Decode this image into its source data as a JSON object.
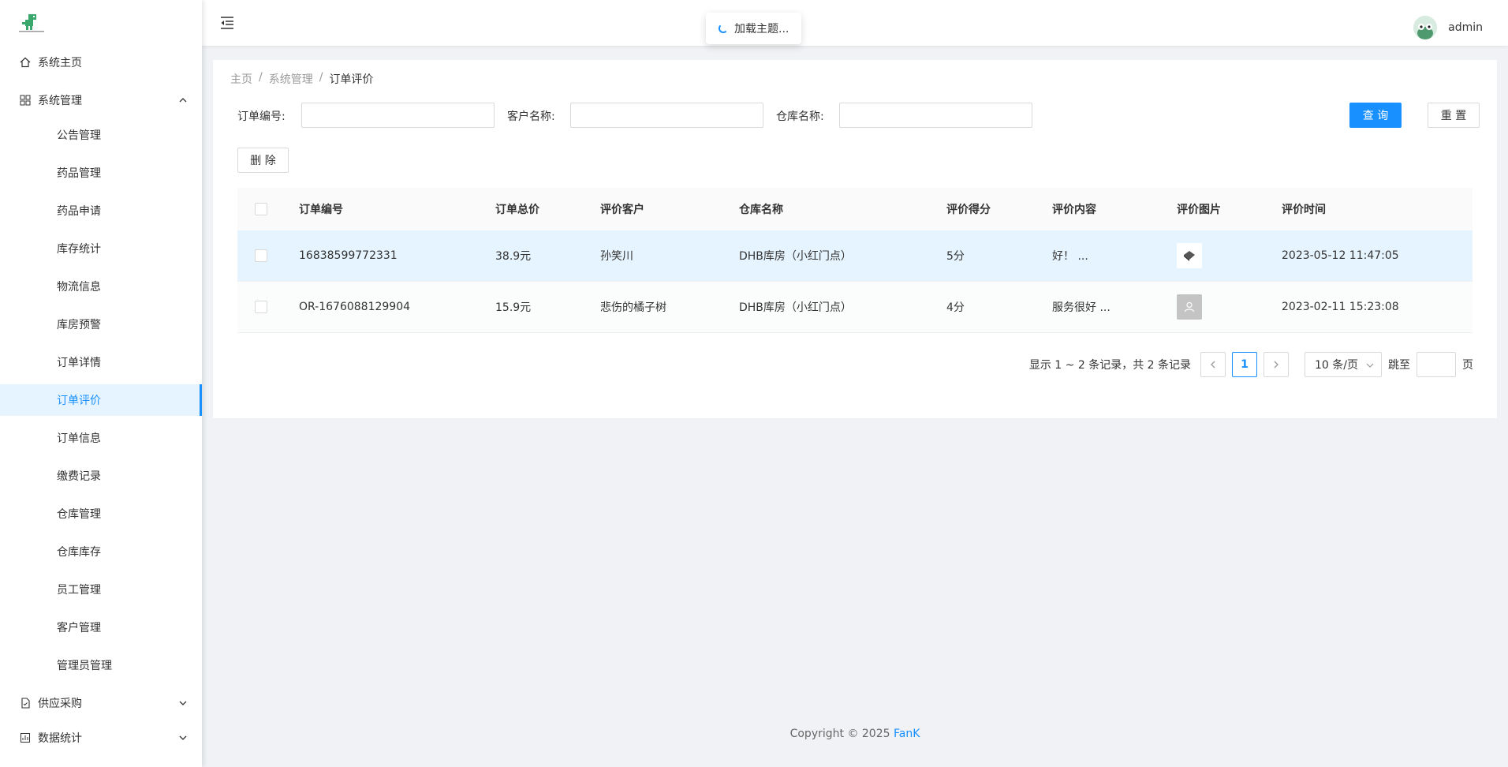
{
  "sidebar": {
    "items": [
      {
        "label": "系统主页",
        "icon": "home-icon",
        "level": 1
      },
      {
        "label": "系统管理",
        "icon": "appstore-icon",
        "level": 1,
        "expanded": true
      },
      {
        "label": "公告管理",
        "level": 2
      },
      {
        "label": "药品管理",
        "level": 2
      },
      {
        "label": "药品申请",
        "level": 2
      },
      {
        "label": "库存统计",
        "level": 2
      },
      {
        "label": "物流信息",
        "level": 2
      },
      {
        "label": "库房预警",
        "level": 2
      },
      {
        "label": "订单详情",
        "level": 2
      },
      {
        "label": "订单评价",
        "level": 2,
        "active": true
      },
      {
        "label": "订单信息",
        "level": 2
      },
      {
        "label": "缴费记录",
        "level": 2
      },
      {
        "label": "仓库管理",
        "level": 2
      },
      {
        "label": "仓库库存",
        "level": 2
      },
      {
        "label": "员工管理",
        "level": 2
      },
      {
        "label": "客户管理",
        "level": 2
      },
      {
        "label": "管理员管理",
        "level": 2
      },
      {
        "label": "供应采购",
        "icon": "file-icon",
        "level": 1,
        "expanded": false
      },
      {
        "label": "数据统计",
        "icon": "chart-icon",
        "level": 1,
        "expanded": false
      }
    ]
  },
  "header": {
    "username": "admin",
    "loading_text": "加载主题..."
  },
  "breadcrumb": [
    "主页",
    "系统管理",
    "订单评价"
  ],
  "search": {
    "order_no_label": "订单编号:",
    "customer_label": "客户名称:",
    "warehouse_label": "仓库名称:",
    "query_label": "查 询",
    "reset_label": "重 置"
  },
  "toolbar": {
    "delete_label": "删 除"
  },
  "table": {
    "columns": [
      "订单编号",
      "订单总价",
      "评价客户",
      "仓库名称",
      "评价得分",
      "评价内容",
      "评价图片",
      "评价时间"
    ],
    "rows": [
      {
        "order_no": "16838599772331",
        "total": "38.9元",
        "customer": "孙笑川",
        "warehouse": "DHB库房（小红门点）",
        "score": "5分",
        "content": "好！ ...",
        "time": "2023-05-12 11:47:05"
      },
      {
        "order_no": "OR-1676088129904",
        "total": "15.9元",
        "customer": "悲伤的橘子树",
        "warehouse": "DHB库房（小红门点）",
        "score": "4分",
        "content": "服务很好 ...",
        "time": "2023-02-11 15:23:08"
      }
    ]
  },
  "pagination": {
    "total_text": "显示 1 ~ 2 条记录，共 2 条记录",
    "current_page": "1",
    "page_size": "10 条/页",
    "jump_label": "跳至",
    "page_unit": "页"
  },
  "footer": {
    "copyright": "Copyright © 2025 ",
    "brand": "FanK"
  },
  "colors": {
    "primary": "#1890ff",
    "active_bg": "#e6f4ff"
  }
}
